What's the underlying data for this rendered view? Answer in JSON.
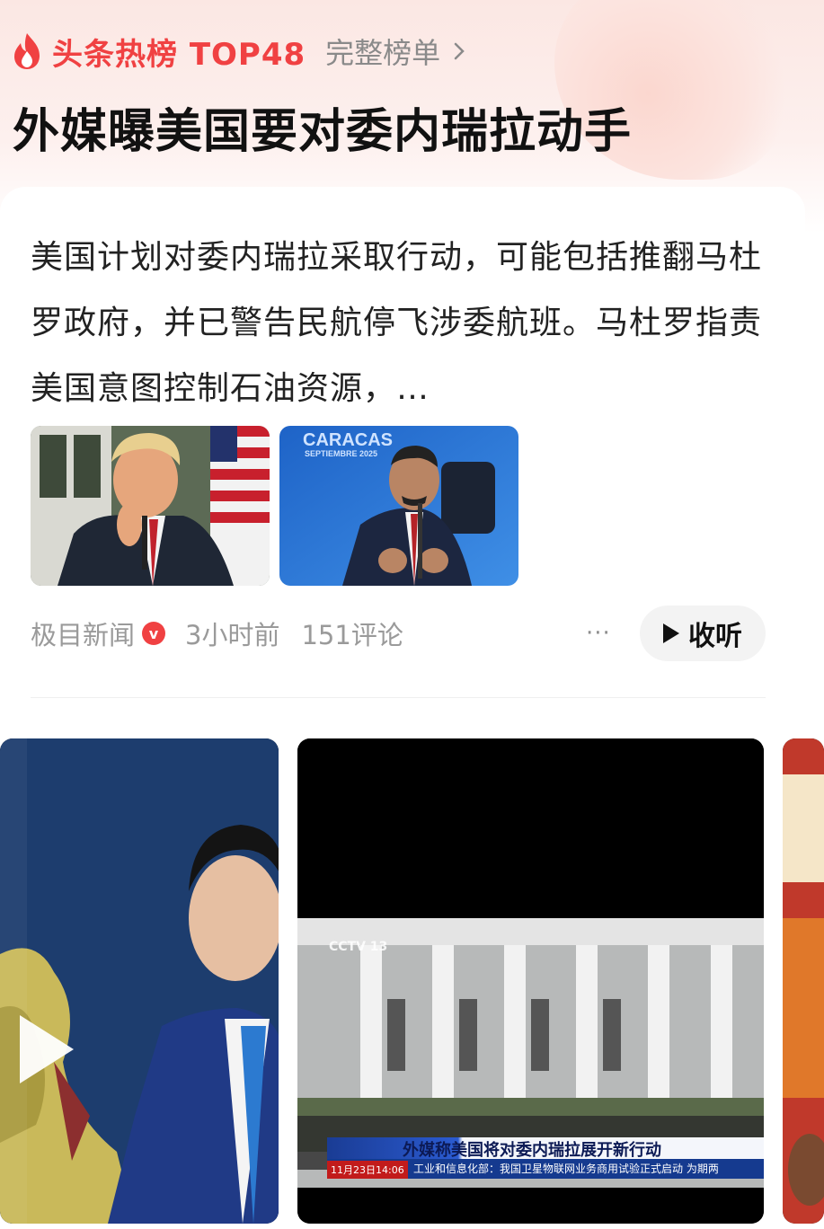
{
  "hotlist": {
    "title": "头条热榜 TOP48",
    "full_list_label": "完整榜单"
  },
  "headline": "外媒曝美国要对委内瑞拉动手",
  "article": {
    "summary": "美国计划对委内瑞拉采取行动，可能包括推翻马杜罗政府，并已警告民航停飞涉委航班。马杜罗指责美国意图控制石油资源，…",
    "thumb2_caption_line1": "CARACAS",
    "thumb2_caption_line2": "SEPTIEMBRE 2025",
    "source": "极目新闻",
    "time": "3小时前",
    "comments": "151评论",
    "more_label": "···",
    "listen_label": "收听"
  },
  "videos": {
    "v2_caption": "外媒称美国将对委内瑞拉展开新行动",
    "v2_timestamp": "11月23日14:06",
    "v2_ticker": "工业和信息化部：我国卫星物联网业务商用试验正式启动  为期两",
    "v2_logo": "CCTV 13"
  },
  "colors": {
    "accent_red": "#f04142",
    "text_dark": "#111111",
    "text_muted": "#9a9a9a"
  },
  "icons": [
    "flame-icon",
    "chevron-right-icon",
    "verified-icon",
    "play-icon"
  ]
}
